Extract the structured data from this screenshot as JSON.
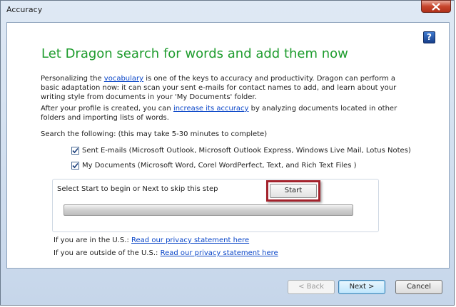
{
  "window": {
    "title": "Accuracy",
    "close_icon": "close-icon",
    "help_icon": "help-icon",
    "help_label": "?"
  },
  "main": {
    "heading": "Let Dragon search for words and add them now",
    "para1": {
      "before_link": "Personalizing the ",
      "link": "vocabulary",
      "after_link": " is one of the keys to accuracy and productivity. Dragon can perform a basic adaptation now: it can scan your sent e-mails for contact names to add, and learn about your writing style from documents in your 'My Documents' folder."
    },
    "para2": {
      "before_link": "After your profile is created, you can ",
      "link": "increase its accuracy",
      "after_link": " by analyzing documents located in other folders and importing lists of words."
    },
    "search_label": "Search the following: (this may take 5-30 minutes to complete)",
    "options": [
      {
        "label": "Sent E-mails (Microsoft Outlook, Microsoft Outlook Express, Windows Live Mail, Lotus Notes)",
        "checked": true
      },
      {
        "label": "My Documents (Microsoft Word, Corel WordPerfect, Text, and Rich Text Files )",
        "checked": true
      }
    ],
    "start_panel": {
      "instruction": "Select Start to begin or Next to skip this step",
      "start_label": "Start",
      "progress": 0
    },
    "privacy": {
      "us_text": "If you are in the U.S.: ",
      "us_link": "Read our privacy statement here",
      "outside_text": "If you are outside of the U.S.: ",
      "outside_link": "Read our privacy statement here"
    }
  },
  "footer": {
    "back_label": "< Back",
    "next_label": "Next >",
    "cancel_label": "Cancel"
  },
  "colors": {
    "heading": "#1f9c2e",
    "link": "#0a46c8",
    "highlight": "#a3222c"
  }
}
